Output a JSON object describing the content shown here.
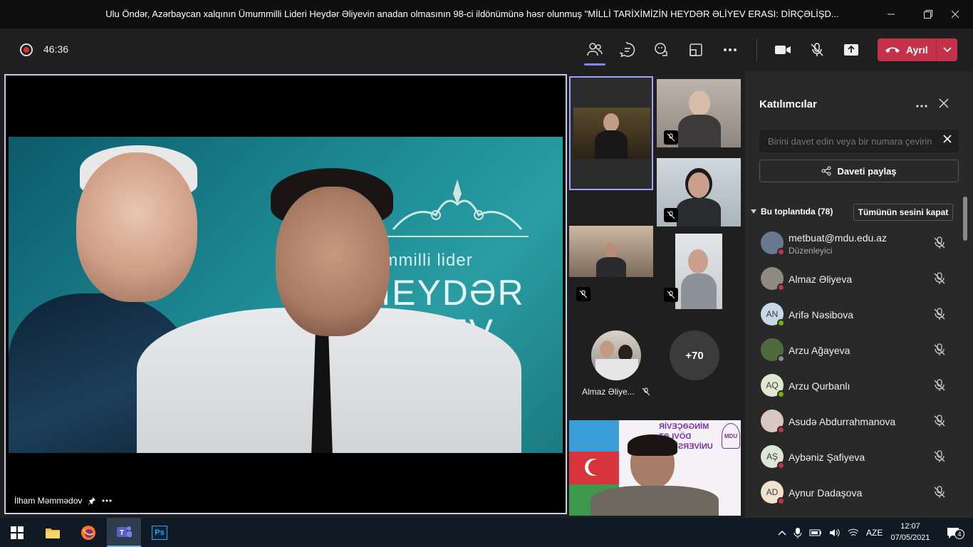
{
  "window": {
    "title": "Ulu Öndər, Azərbaycan xalqının Ümummilli Lideri Heydər Əliyevin anadan olmasının 98-ci ildönümünə həsr olunmuş \"MİLLİ TARİXİMİZİN HEYDƏR ƏLİYEV ERASI: DİRÇƏLİŞD...",
    "minimize_icon": "minimize-icon",
    "maximize_icon": "maximize-icon",
    "close_icon": "close-icon"
  },
  "toolbar": {
    "timer": "46:36",
    "leave_label": "Ayrıl",
    "recording_color": "#e02b2b",
    "leave_color": "#c4314b"
  },
  "stage": {
    "presenter_name": "İlham Məmmədov",
    "overlay_line1": "ummilli lider",
    "overlay_line2": "HEYDƏR",
    "overlay_line3": "İYEV"
  },
  "gallery": {
    "tile_name": "Almaz Əliye...",
    "overflow_count": "+70",
    "university_line1": "MİNGƏÇEVİR",
    "university_line2": "DÖVLƏT",
    "university_line3": "UNİVERSİTETİ",
    "university_badge": "MDU"
  },
  "panel": {
    "title": "Katılımcılar",
    "invite_placeholder": "Birini davet edin veya bir numara çevirin",
    "share_label": "Daveti paylaş",
    "section_label": "Bu toplantıda (78)",
    "mute_all_label": "Tümünün sesini kapat",
    "participants": [
      {
        "name": "metbuat@mdu.edu.az",
        "role": "Düzenleyici",
        "initials": "",
        "status": "#c4314b"
      },
      {
        "name": "Almaz Əliyeva",
        "role": "",
        "initials": "",
        "status": "#c4314b"
      },
      {
        "name": "Arifə Nəsibova",
        "role": "",
        "initials": "AN",
        "status": "#6bb700"
      },
      {
        "name": "Arzu Ağayeva",
        "role": "",
        "initials": "",
        "status": "#8a8a8a"
      },
      {
        "name": "Arzu Qurbanlı",
        "role": "",
        "initials": "AQ",
        "status": "#6bb700"
      },
      {
        "name": "Asudə Abdurrahmanova",
        "role": "",
        "initials": "",
        "status": "#c4314b"
      },
      {
        "name": "Aybəniz Şafiyeva",
        "role": "",
        "initials": "AŞ",
        "status": "#c4314b"
      },
      {
        "name": "Aynur Dadaşova",
        "role": "",
        "initials": "AD",
        "status": "#c4314b"
      }
    ]
  },
  "taskbar": {
    "language": "AZE",
    "time": "12:07",
    "date": "07/05/2021",
    "notification_count": "4",
    "apps": [
      "start-icon",
      "file-explorer-icon",
      "firefox-icon",
      "teams-icon",
      "photoshop-icon"
    ],
    "ps_label": "Ps"
  }
}
